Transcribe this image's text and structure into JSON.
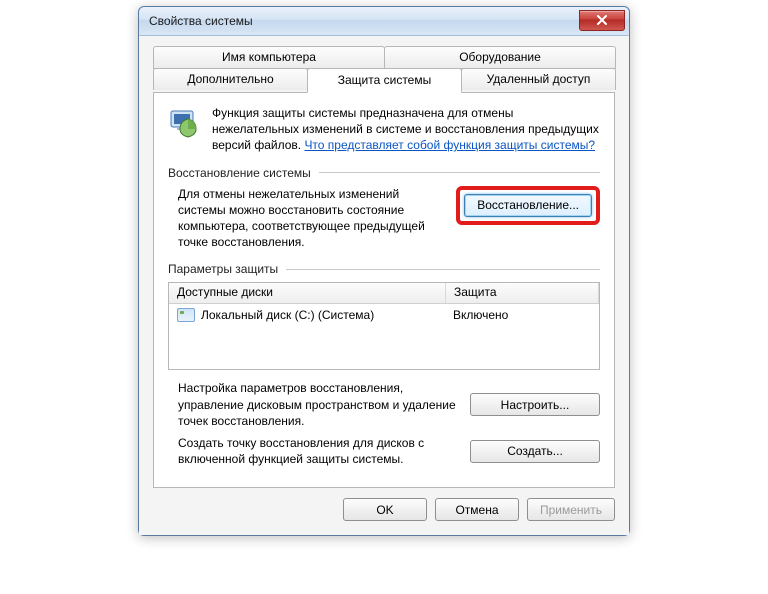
{
  "window": {
    "title": "Свойства системы"
  },
  "tabs": {
    "row1": [
      "Имя компьютера",
      "Оборудование"
    ],
    "row2": [
      "Дополнительно",
      "Защита системы",
      "Удаленный доступ"
    ],
    "active": "Защита системы"
  },
  "intro": {
    "text_before_link": "Функция защиты системы предназначена для отмены нежелательных изменений в системе и восстановления предыдущих версий файлов. ",
    "link": "Что представляет собой функция защиты системы?"
  },
  "restore": {
    "section": "Восстановление системы",
    "desc": "Для отмены нежелательных изменений системы можно восстановить состояние компьютера, соответствующее предыдущей точке восстановления.",
    "button": "Восстановление..."
  },
  "protection": {
    "section": "Параметры защиты",
    "columns": [
      "Доступные диски",
      "Защита"
    ],
    "rows": [
      {
        "name": "Локальный диск (C:) (Система)",
        "status": "Включено"
      }
    ],
    "configure_desc": "Настройка параметров восстановления, управление дисковым пространством и удаление точек восстановления.",
    "configure_button": "Настроить...",
    "create_desc": "Создать точку восстановления для дисков с включенной функцией защиты системы.",
    "create_button": "Создать..."
  },
  "dialog": {
    "ok": "OK",
    "cancel": "Отмена",
    "apply": "Применить"
  }
}
